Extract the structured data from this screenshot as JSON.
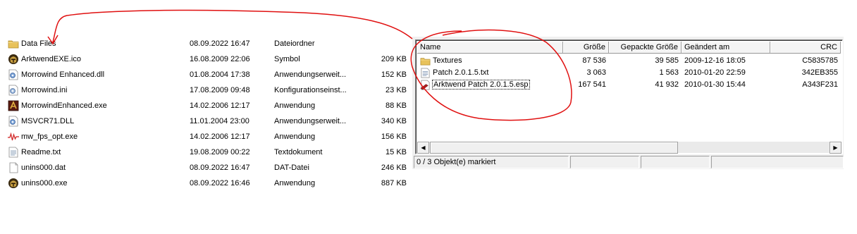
{
  "left_files": [
    {
      "name": "Data Files",
      "date": "08.09.2022 16:47",
      "type": "Dateiordner",
      "size": "",
      "icon": "folder-icon"
    },
    {
      "name": "ArktwendEXE.ico",
      "date": "16.08.2009 22:06",
      "type": "Symbol",
      "size": "209 KB",
      "icon": "helmet-icon"
    },
    {
      "name": "Morrowind Enhanced.dll",
      "date": "01.08.2004 17:38",
      "type": "Anwendungserweit...",
      "size": "152 KB",
      "icon": "dll-gear-icon"
    },
    {
      "name": "Morrowind.ini",
      "date": "17.08.2009 09:48",
      "type": "Konfigurationseinst...",
      "size": "23 KB",
      "icon": "ini-gear-icon"
    },
    {
      "name": "MorrowindEnhanced.exe",
      "date": "14.02.2006 12:17",
      "type": "Anwendung",
      "size": "88 KB",
      "icon": "app-icon"
    },
    {
      "name": "MSVCR71.DLL",
      "date": "11.01.2004 23:00",
      "type": "Anwendungserweit...",
      "size": "340 KB",
      "icon": "dll-gear-icon"
    },
    {
      "name": "mw_fps_opt.exe",
      "date": "14.02.2006 12:17",
      "type": "Anwendung",
      "size": "156 KB",
      "icon": "waveform-icon"
    },
    {
      "name": "Readme.txt",
      "date": "19.08.2009 00:22",
      "type": "Textdokument",
      "size": "15 KB",
      "icon": "text-file-icon"
    },
    {
      "name": "unins000.dat",
      "date": "08.09.2022 16:47",
      "type": "DAT-Datei",
      "size": "246 KB",
      "icon": "blank-file-icon"
    },
    {
      "name": "unins000.exe",
      "date": "08.09.2022 16:46",
      "type": "Anwendung",
      "size": "887 KB",
      "icon": "helmet-icon"
    }
  ],
  "archive": {
    "columns": {
      "name": "Name",
      "size": "Größe",
      "packed": "Gepackte Größe",
      "modified": "Geändert am",
      "crc": "CRC"
    },
    "rows": [
      {
        "name": "Textures",
        "size": "87 536",
        "packed": "39 585",
        "modified": "2009-12-16 18:05",
        "crc": "C5835785",
        "icon": "folder-icon"
      },
      {
        "name": "Patch 2.0.1.5.txt",
        "size": "3 063",
        "packed": "1 563",
        "modified": "2010-01-20 22:59",
        "crc": "342EB355",
        "icon": "text-file-icon"
      },
      {
        "name": "Arktwend Patch 2.0.1.5.esp",
        "size": "167 541",
        "packed": "41 932",
        "modified": "2010-01-30 15:44",
        "crc": "A343F231",
        "icon": "plugin-file-icon"
      }
    ],
    "status": "0 / 3 Objekt(e) markiert"
  },
  "colors": {
    "annotation": "#e01010",
    "folder": "#e8c25a",
    "selection_border": "#000000"
  }
}
